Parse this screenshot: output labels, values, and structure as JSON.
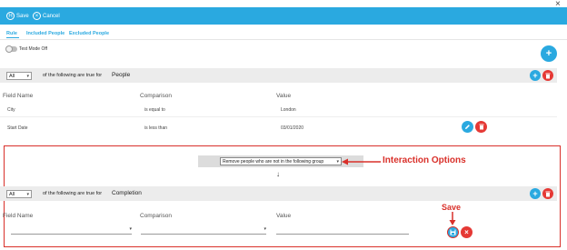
{
  "window": {
    "close_glyph": "×"
  },
  "toolbar": {
    "save_label": "Save",
    "cancel_label": "Cancel",
    "save_icon": "H",
    "cancel_icon": "×",
    "color": "#2aa9e0"
  },
  "tabs": [
    {
      "label": "Rule",
      "active": true
    },
    {
      "label": "Included People",
      "active": false
    },
    {
      "label": "Excluded People",
      "active": false
    }
  ],
  "test_mode": {
    "label": "Test Mode Off",
    "on": false
  },
  "add_rule_glyph": "+",
  "groups": [
    {
      "quantifier": "All",
      "text": "of the following are true for",
      "name": "People",
      "columns": [
        "Field Name",
        "Comparison",
        "Value"
      ],
      "rows": [
        {
          "field": "City",
          "comparison": "is equal to",
          "value": "London"
        },
        {
          "field": "Start Date",
          "comparison": "is less than",
          "value": "03/01/2020"
        }
      ]
    },
    {
      "quantifier": "All",
      "text": "of the following are true for",
      "name": "Completion",
      "columns": [
        "Field Name",
        "Comparison",
        "Value"
      ]
    }
  ],
  "interaction": {
    "selected_option": "Remove people who are not in the following group",
    "down_arrow": "↓"
  },
  "annotations": {
    "interaction_label": "Interaction Options",
    "save_label": "Save",
    "color": "#d9302a"
  },
  "icons": {
    "add": "add-icon",
    "delete": "trash-icon",
    "edit": "pencil-icon",
    "save": "floppy-icon",
    "cancel": "close-icon"
  },
  "colors": {
    "add": "#2aa9e0",
    "delete": "#e53935",
    "save": "#2aa9e0"
  }
}
